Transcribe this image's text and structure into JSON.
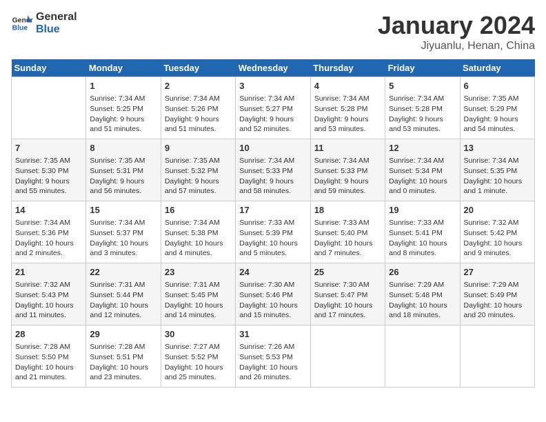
{
  "logo": {
    "line1": "General",
    "line2": "Blue"
  },
  "title": "January 2024",
  "location": "Jiyuanlu, Henan, China",
  "header_days": [
    "Sunday",
    "Monday",
    "Tuesday",
    "Wednesday",
    "Thursday",
    "Friday",
    "Saturday"
  ],
  "weeks": [
    [
      {
        "day": "",
        "info": ""
      },
      {
        "day": "1",
        "info": "Sunrise: 7:34 AM\nSunset: 5:25 PM\nDaylight: 9 hours\nand 51 minutes."
      },
      {
        "day": "2",
        "info": "Sunrise: 7:34 AM\nSunset: 5:26 PM\nDaylight: 9 hours\nand 51 minutes."
      },
      {
        "day": "3",
        "info": "Sunrise: 7:34 AM\nSunset: 5:27 PM\nDaylight: 9 hours\nand 52 minutes."
      },
      {
        "day": "4",
        "info": "Sunrise: 7:34 AM\nSunset: 5:28 PM\nDaylight: 9 hours\nand 53 minutes."
      },
      {
        "day": "5",
        "info": "Sunrise: 7:34 AM\nSunset: 5:28 PM\nDaylight: 9 hours\nand 53 minutes."
      },
      {
        "day": "6",
        "info": "Sunrise: 7:35 AM\nSunset: 5:29 PM\nDaylight: 9 hours\nand 54 minutes."
      }
    ],
    [
      {
        "day": "7",
        "info": "Sunrise: 7:35 AM\nSunset: 5:30 PM\nDaylight: 9 hours\nand 55 minutes."
      },
      {
        "day": "8",
        "info": "Sunrise: 7:35 AM\nSunset: 5:31 PM\nDaylight: 9 hours\nand 56 minutes."
      },
      {
        "day": "9",
        "info": "Sunrise: 7:35 AM\nSunset: 5:32 PM\nDaylight: 9 hours\nand 57 minutes."
      },
      {
        "day": "10",
        "info": "Sunrise: 7:34 AM\nSunset: 5:33 PM\nDaylight: 9 hours\nand 58 minutes."
      },
      {
        "day": "11",
        "info": "Sunrise: 7:34 AM\nSunset: 5:33 PM\nDaylight: 9 hours\nand 59 minutes."
      },
      {
        "day": "12",
        "info": "Sunrise: 7:34 AM\nSunset: 5:34 PM\nDaylight: 10 hours\nand 0 minutes."
      },
      {
        "day": "13",
        "info": "Sunrise: 7:34 AM\nSunset: 5:35 PM\nDaylight: 10 hours\nand 1 minute."
      }
    ],
    [
      {
        "day": "14",
        "info": "Sunrise: 7:34 AM\nSunset: 5:36 PM\nDaylight: 10 hours\nand 2 minutes."
      },
      {
        "day": "15",
        "info": "Sunrise: 7:34 AM\nSunset: 5:37 PM\nDaylight: 10 hours\nand 3 minutes."
      },
      {
        "day": "16",
        "info": "Sunrise: 7:34 AM\nSunset: 5:38 PM\nDaylight: 10 hours\nand 4 minutes."
      },
      {
        "day": "17",
        "info": "Sunrise: 7:33 AM\nSunset: 5:39 PM\nDaylight: 10 hours\nand 5 minutes."
      },
      {
        "day": "18",
        "info": "Sunrise: 7:33 AM\nSunset: 5:40 PM\nDaylight: 10 hours\nand 7 minutes."
      },
      {
        "day": "19",
        "info": "Sunrise: 7:33 AM\nSunset: 5:41 PM\nDaylight: 10 hours\nand 8 minutes."
      },
      {
        "day": "20",
        "info": "Sunrise: 7:32 AM\nSunset: 5:42 PM\nDaylight: 10 hours\nand 9 minutes."
      }
    ],
    [
      {
        "day": "21",
        "info": "Sunrise: 7:32 AM\nSunset: 5:43 PM\nDaylight: 10 hours\nand 11 minutes."
      },
      {
        "day": "22",
        "info": "Sunrise: 7:31 AM\nSunset: 5:44 PM\nDaylight: 10 hours\nand 12 minutes."
      },
      {
        "day": "23",
        "info": "Sunrise: 7:31 AM\nSunset: 5:45 PM\nDaylight: 10 hours\nand 14 minutes."
      },
      {
        "day": "24",
        "info": "Sunrise: 7:30 AM\nSunset: 5:46 PM\nDaylight: 10 hours\nand 15 minutes."
      },
      {
        "day": "25",
        "info": "Sunrise: 7:30 AM\nSunset: 5:47 PM\nDaylight: 10 hours\nand 17 minutes."
      },
      {
        "day": "26",
        "info": "Sunrise: 7:29 AM\nSunset: 5:48 PM\nDaylight: 10 hours\nand 18 minutes."
      },
      {
        "day": "27",
        "info": "Sunrise: 7:29 AM\nSunset: 5:49 PM\nDaylight: 10 hours\nand 20 minutes."
      }
    ],
    [
      {
        "day": "28",
        "info": "Sunrise: 7:28 AM\nSunset: 5:50 PM\nDaylight: 10 hours\nand 21 minutes."
      },
      {
        "day": "29",
        "info": "Sunrise: 7:28 AM\nSunset: 5:51 PM\nDaylight: 10 hours\nand 23 minutes."
      },
      {
        "day": "30",
        "info": "Sunrise: 7:27 AM\nSunset: 5:52 PM\nDaylight: 10 hours\nand 25 minutes."
      },
      {
        "day": "31",
        "info": "Sunrise: 7:26 AM\nSunset: 5:53 PM\nDaylight: 10 hours\nand 26 minutes."
      },
      {
        "day": "",
        "info": ""
      },
      {
        "day": "",
        "info": ""
      },
      {
        "day": "",
        "info": ""
      }
    ]
  ]
}
